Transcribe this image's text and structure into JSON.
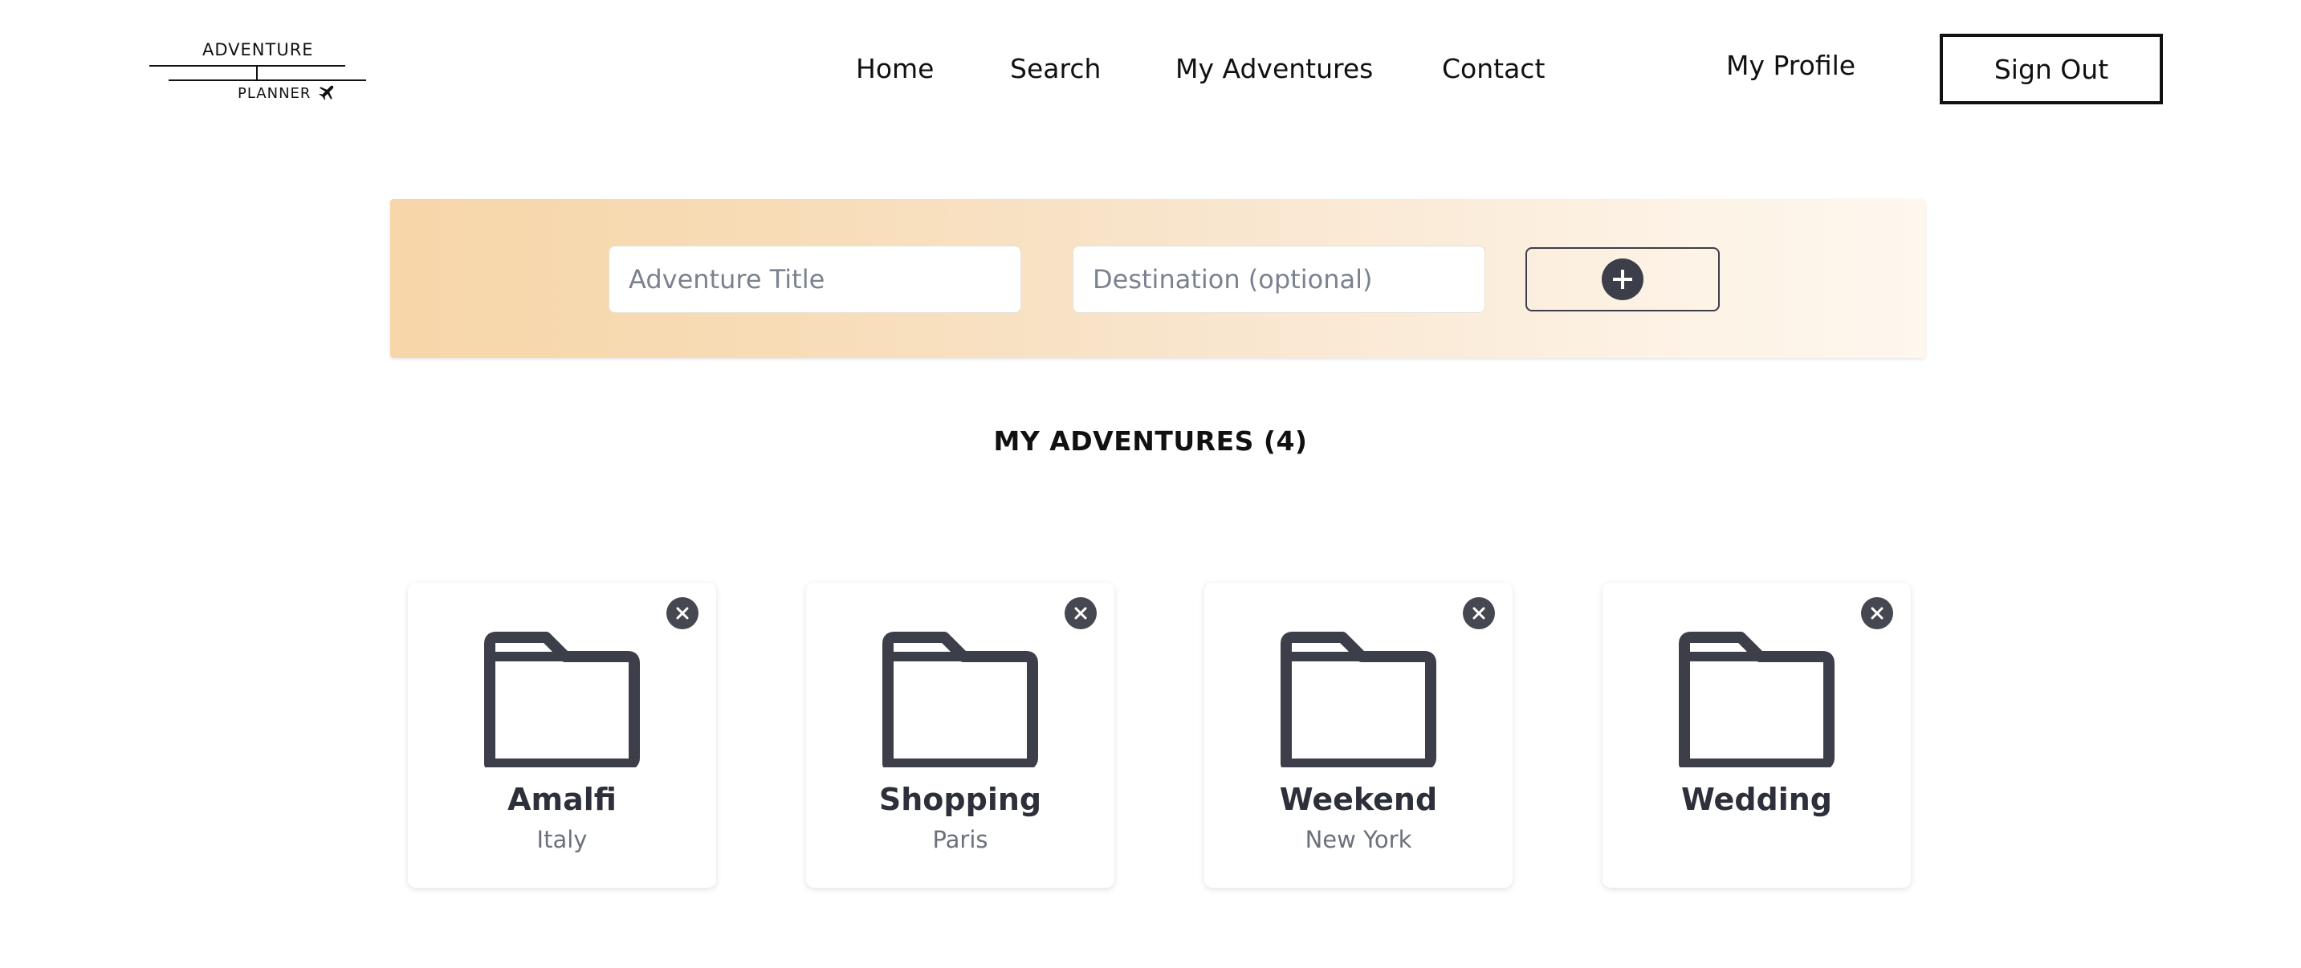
{
  "logo": {
    "line1": "ADVENTURE",
    "line2": "PLANNER",
    "icon": "airplane-icon"
  },
  "nav": {
    "home": "Home",
    "search": "Search",
    "my_adventures": "My Adventures",
    "contact": "Contact",
    "my_profile": "My Profile",
    "sign_out": "Sign Out"
  },
  "add_form": {
    "title_placeholder": "Adventure Title",
    "title_value": "",
    "destination_placeholder": "Destination (optional)",
    "destination_value": "",
    "add_icon": "plus-circle-icon"
  },
  "section": {
    "title": "MY ADVENTURES (4)"
  },
  "adventures": [
    {
      "title": "Amalfi",
      "destination": "Italy",
      "icon": "folder-icon"
    },
    {
      "title": "Shopping",
      "destination": "Paris",
      "icon": "folder-icon"
    },
    {
      "title": "Weekend",
      "destination": "New York",
      "icon": "folder-icon"
    },
    {
      "title": "Wedding",
      "destination": "",
      "icon": "folder-icon"
    }
  ],
  "colors": {
    "accent_dark": "#3c3f4a",
    "panel_gradient_start": "#f7d6a9",
    "panel_gradient_end": "#fef7ee",
    "muted_text": "#6b707c"
  }
}
